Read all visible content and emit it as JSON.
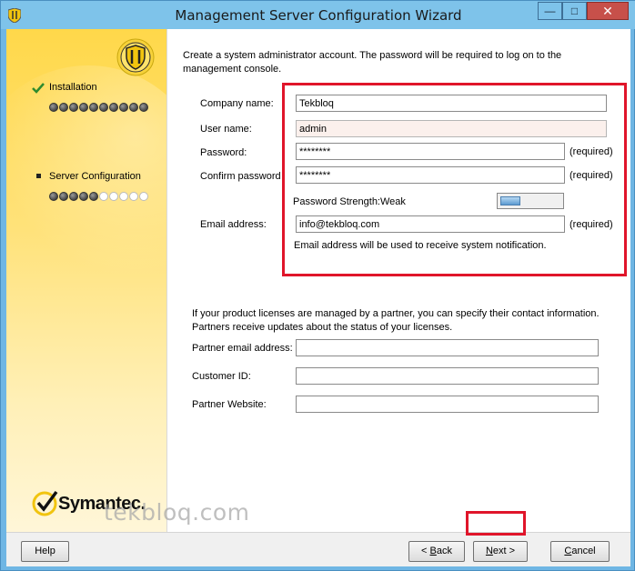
{
  "window": {
    "title": "Management Server Configuration Wizard",
    "minimize_glyph": "—",
    "maximize_glyph": "□",
    "close_glyph": "✕"
  },
  "sidebar": {
    "steps": [
      {
        "label": "Installation",
        "status": "complete",
        "icon": "check-icon",
        "progress_filled": 10,
        "progress_total": 10
      },
      {
        "label": "Server Configuration",
        "status": "current",
        "icon": "bullet-icon",
        "progress_filled": 5,
        "progress_total": 10
      }
    ],
    "brand": "Symantec."
  },
  "main": {
    "intro": "Create a system administrator account. The password will be required to log on to the management console.",
    "account": {
      "company_label": "Company name:",
      "company_value": "Tekbloq",
      "username_label": "User name:",
      "username_value": "admin",
      "password_label": "Password:",
      "password_value": "********",
      "confirm_label": "Confirm password",
      "confirm_value": "********",
      "required_text": "(required)",
      "strength_label": "Password Strength:Weak",
      "strength_level": 0.33,
      "email_label": "Email address:",
      "email_value": "info@tekbloq.com",
      "email_note": "Email address will be used to receive system notification."
    },
    "partner": {
      "intro": "If your product licenses are managed by a partner, you can specify their contact information. Partners receive updates about the status of your licenses.",
      "email_label": "Partner email address:",
      "email_value": "",
      "customer_label": "Customer ID:",
      "customer_value": "",
      "website_label": "Partner Website:",
      "website_value": ""
    }
  },
  "footer": {
    "help": "Help",
    "back_prefix": "< ",
    "back_accel": "B",
    "back_rest": "ack",
    "next_accel": "N",
    "next_rest": "ext >",
    "cancel_accel": "C",
    "cancel_rest": "ancel"
  },
  "watermark": "tekbloq.com",
  "colors": {
    "highlight_red": "#e0152a",
    "sidebar_yellow": "#ffd84a",
    "titlebar_blue": "#7ec3ea",
    "close_red": "#c7504a"
  }
}
